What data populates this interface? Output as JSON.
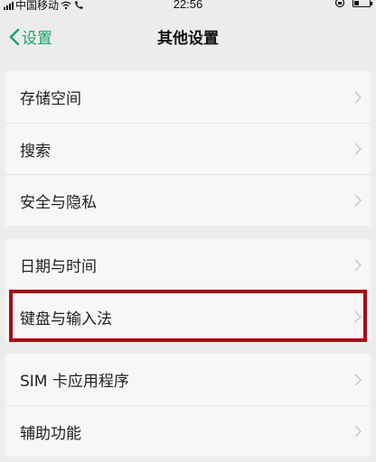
{
  "status_bar": {
    "carrier": "中国移动",
    "time": "22:56"
  },
  "nav": {
    "back_label": "设置",
    "title": "其他设置"
  },
  "groups": [
    {
      "items": [
        {
          "label": "存储空间"
        },
        {
          "label": "搜索"
        },
        {
          "label": "安全与隐私"
        }
      ]
    },
    {
      "items": [
        {
          "label": "日期与时间"
        },
        {
          "label": "键盘与输入法"
        }
      ]
    },
    {
      "items": [
        {
          "label": "SIM 卡应用程序"
        },
        {
          "label": "辅助功能"
        }
      ]
    }
  ],
  "highlighted_item": "键盘与输入法",
  "colors": {
    "accent": "#19a36a",
    "highlight": "#a50e17",
    "background": "#ececec",
    "card": "#f7f7f7"
  }
}
